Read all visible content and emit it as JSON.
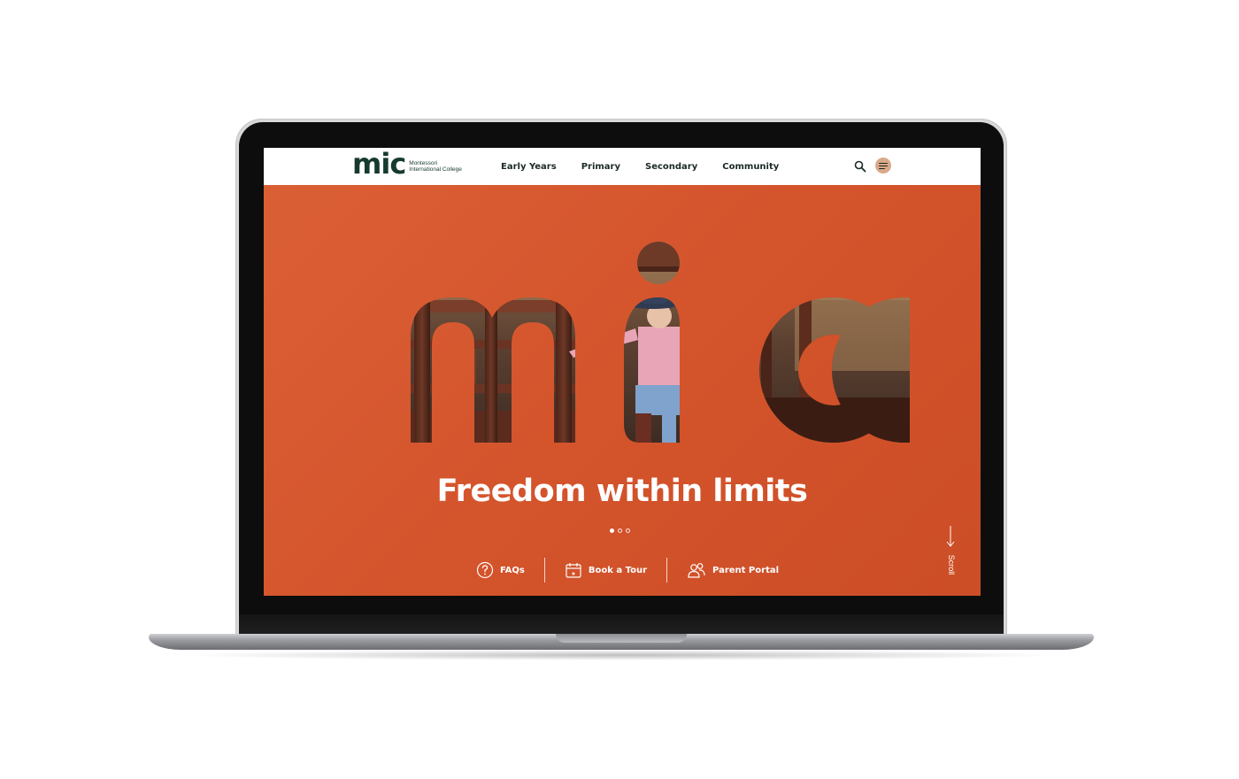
{
  "colors": {
    "hero_orange": "#d4552c",
    "brand_green": "#163a2e",
    "menu_button": "#d9a989"
  },
  "header": {
    "logo_mark": "mic",
    "logo_text": "Montessori International College",
    "nav": [
      {
        "label": "Early Years"
      },
      {
        "label": "Primary"
      },
      {
        "label": "Secondary"
      },
      {
        "label": "Community"
      }
    ],
    "icons": [
      "search-icon",
      "menu-icon"
    ]
  },
  "hero": {
    "graphic": "mic",
    "tagline": "Freedom within limits",
    "carousel": {
      "slides": 3,
      "active": 1
    },
    "quick_links": [
      {
        "label": "FAQs",
        "icon": "question-circle-icon"
      },
      {
        "label": "Book a Tour",
        "icon": "calendar-icon"
      },
      {
        "label": "Parent Portal",
        "icon": "people-icon"
      }
    ],
    "scroll_label": "Scroll"
  }
}
